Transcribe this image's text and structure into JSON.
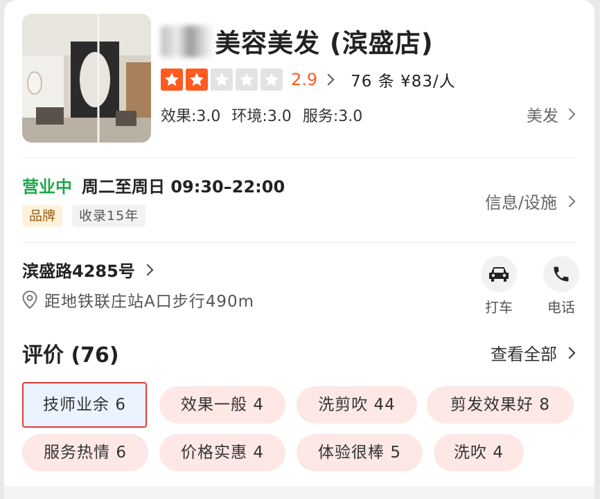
{
  "shop": {
    "name_hidden": "⬛",
    "name_visible": "美容美发 (滨盛店)",
    "score": "2.9",
    "review_meta": "76 条 ¥83/人",
    "stars": 2,
    "stars_total": 5,
    "sub_scores": [
      "效果:3.0",
      "环境:3.0",
      "服务:3.0"
    ],
    "category": "美发",
    "open_status": "营业中",
    "hours": "周二至周日 09:30–22:00",
    "tags": [
      "品牌",
      "收录15年"
    ],
    "info_link": "信息/设施",
    "address": "滨盛路4285号",
    "distance": "距地铁联庄站A口步行490m",
    "actions": {
      "taxi": "打车",
      "phone": "电话"
    }
  },
  "reviews": {
    "title": "评价 (76)",
    "view_all": "查看全部",
    "chips": [
      {
        "label": "技师业余 6",
        "selected": true
      },
      {
        "label": "效果一般 4"
      },
      {
        "label": "洗剪吹 44"
      },
      {
        "label": "剪发效果好 8"
      },
      {
        "label": "服务热情 6"
      },
      {
        "label": "价格实惠 4"
      },
      {
        "label": "体验很棒 5"
      },
      {
        "label": "洗吹 4"
      }
    ]
  },
  "colors": {
    "accent": "#ff5a1f",
    "open": "#1fa74a",
    "chip_bg": "#fde8e6"
  }
}
